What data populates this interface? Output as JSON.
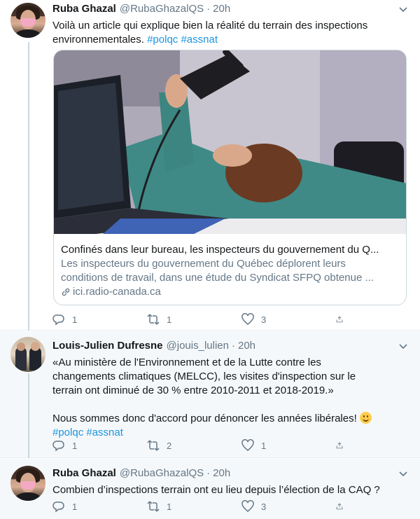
{
  "tweets": [
    {
      "author": "Ruba Ghazal",
      "handle": "@RubaGhazalQS",
      "time": "20h",
      "text": "Voilà un article qui explique bien la réalité du terrain des inspections environnementales.",
      "hashtags": [
        "#polqc",
        "#assnat"
      ],
      "card": {
        "title": "Confinés dans leur bureau, les inspecteurs du gouvernement du Q...",
        "description_line1": "Les inspecteurs du gouvernement du Québec déplorent leurs",
        "description_line2": "conditions de travail, dans une étude du Syndicat SFPQ obtenue ...",
        "domain": "ici.radio-canada.ca"
      },
      "replies": "1",
      "retweets": "1",
      "likes": "3"
    },
    {
      "author": "Louis-Julien Dufresne",
      "handle": "@jouis_lulien",
      "time": "20h",
      "text": "«Au ministère de l'Environnement et de la Lutte contre les\nchangements climatiques (MELCC), les visites d'inspection sur le\nterrain ont diminué de 30 % entre 2010-2011 et 2018-2019.»\n\nNous sommes donc d'accord pour dénoncer les années libérales!",
      "hashtags": [
        "#polqc",
        "#assnat"
      ],
      "replies": "1",
      "retweets": "2",
      "likes": "1"
    },
    {
      "author": "Ruba Ghazal",
      "handle": "@RubaGhazalQS",
      "time": "20h",
      "text": "Combien d’inspections terrain ont eu lieu depuis l’élection de la CAQ ?",
      "replies": "1",
      "retweets": "1",
      "likes": "3"
    }
  ],
  "colors": {
    "link": "#1b95e0",
    "muted": "#657786",
    "border": "#e6ecf0",
    "thread_line": "#ccd6dd"
  },
  "icons": [
    "reply-icon",
    "retweet-icon",
    "like-icon",
    "share-icon",
    "caret-down-icon",
    "link-icon"
  ]
}
